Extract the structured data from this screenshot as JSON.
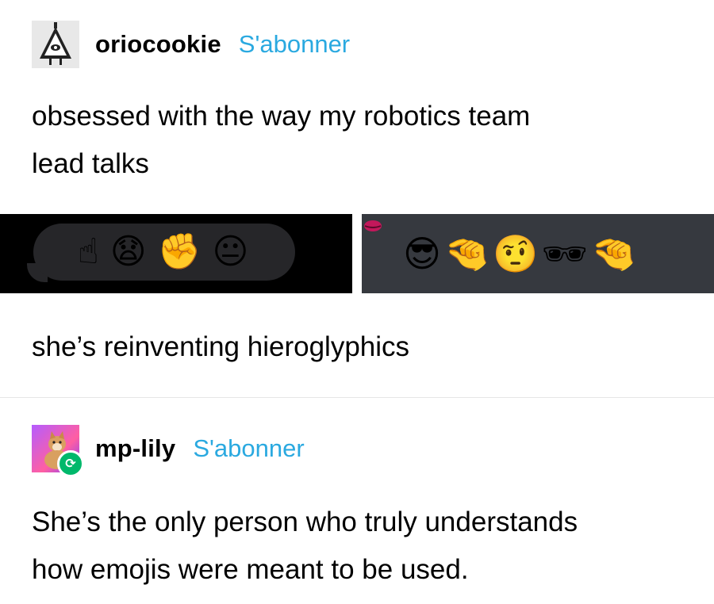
{
  "post1": {
    "username": "oriocookie",
    "follow_label": "S'abonner",
    "text_line1": "obsessed with the way my robotics team",
    "text_line2": "lead talks",
    "caption": "she’s reinventing hieroglyphics"
  },
  "emoji_panels": {
    "left": [
      "☝",
      "😧",
      "✊",
      "😐"
    ],
    "right": [
      "😎",
      "🤏",
      "🤨",
      "🕶",
      "🤏"
    ]
  },
  "post2": {
    "username": "mp-lily",
    "follow_label": "S'abonner",
    "text_line1": "She’s the only person who truly understands",
    "text_line2": "how emojis were meant to be used."
  },
  "colors": {
    "follow": "#2aa9e0",
    "reblog_badge": "#00b86b",
    "panel_left_bg": "#000000",
    "panel_right_bg": "#36393f"
  }
}
